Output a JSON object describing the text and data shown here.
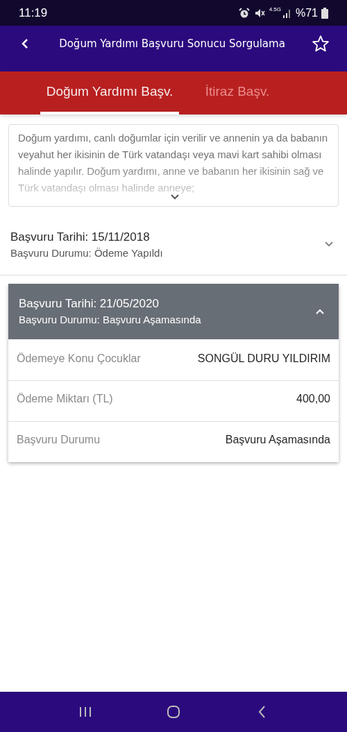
{
  "status_bar": {
    "time": "11:19",
    "network": "4.5G",
    "battery": "%71"
  },
  "header": {
    "title": "Doğum Yardımı Başvuru Sonucu Sorgulama",
    "favorite": false
  },
  "tabs": [
    {
      "label": "Doğum Yardımı Başv.",
      "selected": true
    },
    {
      "label": "İtiraz Başv.",
      "selected": false
    }
  ],
  "description": {
    "text": "Doğum yardımı, canlı doğumlar için verilir ve annenin ya da babanın veyahut her ikisinin de Türk vatandaşı veya mavi kart sahibi olması halinde yapılır. Doğum yardımı, anne ve babanın her ikisinin sağ ve Türk vatandaşı olması halinde anneye;",
    "expanded": false
  },
  "applications": [
    {
      "date": "Başvuru Tarihi: 15/11/2018",
      "status": "Başvuru Durumu: Ödeme Yapıldı",
      "expanded": false
    },
    {
      "date": "Başvuru Tarihi: 21/05/2020",
      "status": "Başvuru Durumu: Başvuru Aşamasında",
      "expanded": true,
      "details": [
        {
          "label": "Ödemeye Konu Çocuklar",
          "value": "SONGÜL DURU YILDIRIM"
        },
        {
          "label": "Ödeme Miktarı (TL)",
          "value": "400,00"
        },
        {
          "label": "Başvuru Durumu",
          "value": "Başvuru Aşamasında"
        }
      ]
    }
  ]
}
